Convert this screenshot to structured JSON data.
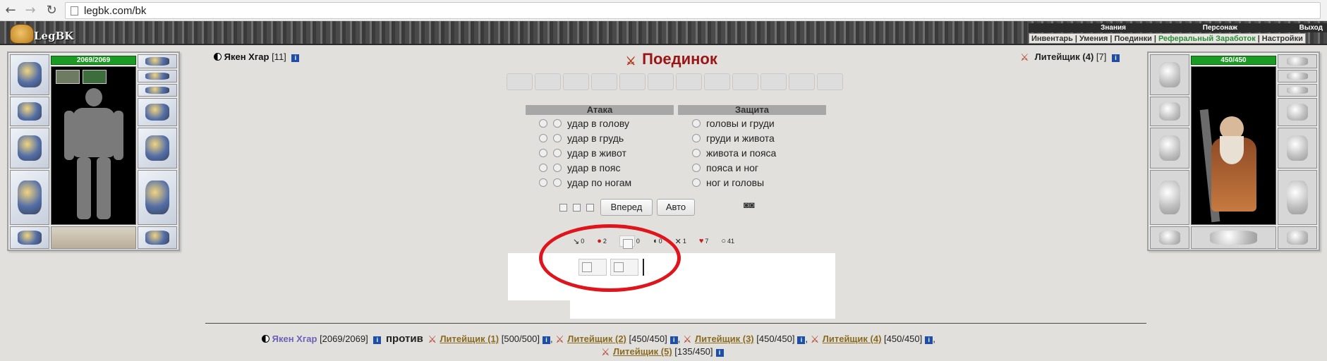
{
  "browser": {
    "back": "←",
    "forward": "→",
    "reload": "↻",
    "url": "legbk.com/bk"
  },
  "site": {
    "logo_text": "LegBK"
  },
  "top_menu": {
    "knowledge": "Знания",
    "character": "Персонаж",
    "exit": "Выход"
  },
  "sub_menu": {
    "inventory": "Инвентарь",
    "skills": "Умения",
    "duels": "Поединки",
    "referral": "Реферальный Заработок",
    "settings": "Настройки",
    "separator": "|"
  },
  "player": {
    "name": "Якен Хгар",
    "level": "[11]",
    "hp": "2069/2069",
    "info": "i"
  },
  "enemy": {
    "name": "Литейщик (4)",
    "level": "[7]",
    "hp": "450/450",
    "info": "i"
  },
  "battle": {
    "title": "Поединок",
    "attack_header": "Атака",
    "defense_header": "Защита",
    "attacks": [
      "удар в голову",
      "удар в грудь",
      "удар в живот",
      "удар в пояс",
      "удар по ногам"
    ],
    "defenses": [
      "головы и груди",
      "груди и живота",
      "живота и пояса",
      "пояса и ног",
      "ног и головы"
    ],
    "forward_button": "Вперед",
    "auto_button": "Авто"
  },
  "stats": [
    {
      "icon": "sword-icon",
      "glyph": "↘",
      "value": "0"
    },
    {
      "icon": "blood-drop-icon",
      "glyph": "●",
      "value": "2"
    },
    {
      "icon": "broken-image-icon",
      "glyph": "",
      "value": "0"
    },
    {
      "icon": "shield-icon",
      "glyph": "◖",
      "value": "0"
    },
    {
      "icon": "cross-swords-icon",
      "glyph": "✕",
      "value": "1"
    },
    {
      "icon": "heart-icon",
      "glyph": "♥",
      "value": "7"
    },
    {
      "icon": "ring-icon",
      "glyph": "○",
      "value": "41"
    }
  ],
  "fighters": {
    "player_name": "Якен Хгар",
    "player_hp": "[2069/2069]",
    "versus": "против",
    "enemies": [
      {
        "name": "Литейщик (1)",
        "hp": "[500/500]"
      },
      {
        "name": "Литейщик (2)",
        "hp": "[450/450]"
      },
      {
        "name": "Литейщик (3)",
        "hp": "[450/450]"
      },
      {
        "name": "Литейщик (4)",
        "hp": "[450/450]"
      },
      {
        "name": "Литейщик (5)",
        "hp": "[135/450]"
      }
    ],
    "comma": ","
  },
  "colors": {
    "title": "#9b1515",
    "hp_bar": "#1b9b24",
    "highlight_ellipse": "#e0151b",
    "player_link": "#6a61b8",
    "enemy_link": "#8a6a1e",
    "referral_link": "#2e8b3a"
  }
}
